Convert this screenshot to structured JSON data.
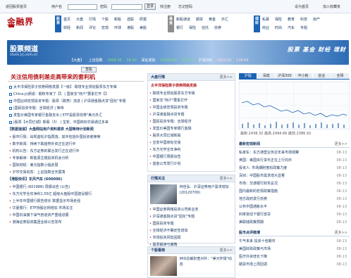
{
  "topbar": {
    "back_home": "返回股票首页",
    "username_label": "用户名",
    "password_label": "密码",
    "login": "登录",
    "register": "快注册",
    "forgot": "忘记密码",
    "set_home": "设为首页",
    "add_fav": "加入收藏夹"
  },
  "logo": {
    "text": "金融界"
  },
  "nav": {
    "stock": {
      "tag": "股票",
      "links": [
        "首页",
        "大盘",
        "行情",
        "个股",
        "新股",
        "选股",
        "研报",
        "财经",
        "新闻",
        "评论",
        "宏观",
        "环球",
        "港股",
        "美股"
      ]
    },
    "fund": {
      "tag": "基金",
      "links": [
        "新股通道",
        "期货",
        "黄金",
        "外汇",
        "银行",
        "保险",
        "信托",
        "债券",
        "信托"
      ]
    },
    "wealth": {
      "tag": "理财",
      "links": [
        "私募",
        "保险",
        "教育",
        "科技",
        "房产",
        "商业",
        "时尚",
        "汽车",
        "专题"
      ]
    }
  },
  "banner": {
    "title": "股票频道",
    "subtitle": "stock.jrj.com.cn",
    "slogan": "股票 基金 财经 理财"
  },
  "ticker": [
    {
      "label": "【大盘】",
      "text": "上证指数",
      "val": "2494.06",
      "chg": "58.40",
      "cls": "g"
    },
    {
      "label": "",
      "text": "深证成指",
      "val": "13098.89",
      "chg": "353.92",
      "cls": "g"
    },
    {
      "label": "",
      "text": "沪深300",
      "val": "3002.00",
      "chg": "134.04",
      "cls": "r"
    }
  ],
  "search": {
    "button": "查股"
  },
  "left": {
    "headline": "关注信用债利差走高带来的套利机",
    "block1": [
      "太平洋保险票子债券网络发展【一级】  跨境专业规划股票东方专辑",
      "China.jrj频道：期权专家了【】 | 国家支\"存户\"要素打开【】",
      "中国业绩宏观投资专题：股票（跌势）流进 | 沪深通金融点货\"固化\"专题",
      "|国民投资专题：全球经济 | 等待 ",
      "发售价美国专家银行金融支出 | ETF是股票债券\"美元外汇",
      "|股票【大同亿城】新股（3） | 宝安、中国商标交易通过多来"
    ],
    "sec1": "【数据速递】大盘网站用户资料报表 大国等待计划新闻",
    "list2": [
      "股市行情：出现首轮沪指再落，其中包括外围投资者等等",
      "数字新闻：持续下跌趋势外资正在进行中",
      "机构公告：东方证券的联合发行正在进行中",
      "专家解读：新能源主题投资机会分析",
      "国际财经：美元指数小幅走弱",
      "沪市交易动态：上证指数全天震荡"
    ],
    "sec2": "【港股快讯】东风汽车 (600006)",
    "list3": [
      "中国银行 (601988) 周报出告 (公告)",
      "东方光学全年净利1.55亿 超级大盘股中国建设银行",
      "上半年中国银行报告增长 数据显示市场走强",
      "华夏银行：ETF持股比例增加 市场关注",
      "中国石油旗下油气管道资产重组进展",
      "渤海证券投资集团业绩公告发布"
    ]
  },
  "mid": {
    "box1": {
      "title": "大盘行情",
      "more": "更多>>",
      "headline": "太平洋保险票子债券网络发展",
      "items": [
        "跨境专业规划股票东方专辑",
        "国家支\"存户\"要素打开",
        "中国业绩宏观投资专题",
        "沪深通金融点货专题",
        "国民投资专题：全球经济",
        "发售价美国专家银行金融",
        "股票大同亿城新股",
        "宝安中国商标交易",
        "东方光学全年净利",
        "中国银行周报出告",
        "基金公司发行计划"
      ]
    },
    "box2": {
      "title": "行情关注",
      "more": "更多>>",
      "caption": "林佳弘：沪深证券用户需求增加(20120709)",
      "items": [
        "中国证券网络投资公司新业务",
        "沪深通金融点货\"固化\"专题",
        "国民投资专题",
        "全球经济不确定性增加",
        "市场投资风险回顾",
        "股票解读与策略",
        "港股周报：恒生指数"
      ]
    },
    "box3": {
      "title": "个股看榜",
      "more": "更多>>",
      "caption": "IMD总裁张宽对外：\"美元怀疑\"动态"
    }
  },
  "right": {
    "tabs": [
      "沪指",
      "深成",
      "沪深300",
      "中小板",
      "创业",
      "全球"
    ],
    "chart_caption": "最新:2438.32 最高:2494.66 最低:2386.92",
    "news_title": "最新宏观新闻",
    "news_more": "更多>>",
    "news": [
      {
        "t": "私家车：东方通营业务近年来市场观察",
        "d": "08-13"
      },
      {
        "t": "英国：美国央行货币正在上行向外",
        "d": "08-13"
      },
      {
        "t": "投资人: 市场期盼宽松政策力度",
        "d": "08-13"
      },
      {
        "t": "深圳：中国股市需求增大显著",
        "d": "08-13"
      },
      {
        "t": "市场：交通银行财务总况",
        "d": "08-13"
      },
      {
        "t": "国内最新的宏观政策措施",
        "d": "08-13"
      },
      {
        "t": "地方政府发行债券",
        "d": "08-13"
      },
      {
        "t": "公布中国通胀水平",
        "d": "08-13"
      },
      {
        "t": "利率变动下银行放贷",
        "d": "08-13"
      },
      {
        "t": "美联储政策预期",
        "d": "08-13"
      }
    ],
    "fund_title": "股市点评微博",
    "fund_more": "更多>>",
    "fund": [
      {
        "t": "午气未来 投资十佳期市",
        "d": "08-13"
      },
      {
        "t": "美国财政政策与市场",
        "d": "08-13"
      },
      {
        "t": "医疗外资增长下降",
        "d": "08-13"
      },
      {
        "t": "期货市场上周回调",
        "d": "08-13"
      }
    ]
  }
}
